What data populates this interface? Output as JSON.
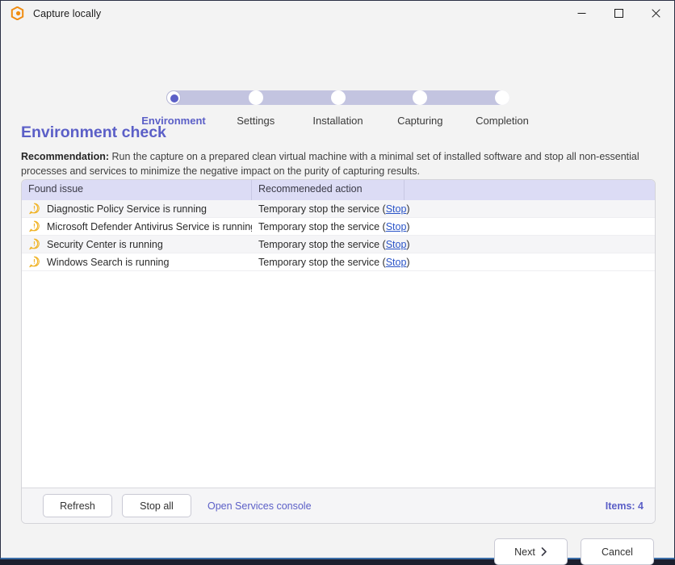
{
  "window": {
    "title": "Capture locally",
    "app_icon": "app-logo-icon",
    "controls": [
      {
        "name": "minimize-button",
        "glyph": "minimize-icon"
      },
      {
        "name": "maximize-button",
        "glyph": "maximize-icon"
      },
      {
        "name": "close-button",
        "glyph": "close-icon"
      }
    ]
  },
  "stepper": {
    "steps": [
      {
        "label": "Environment",
        "active": true
      },
      {
        "label": "Settings",
        "active": false
      },
      {
        "label": "Installation",
        "active": false
      },
      {
        "label": "Capturing",
        "active": false
      },
      {
        "label": "Completion",
        "active": false
      }
    ]
  },
  "page": {
    "title": "Environment check",
    "recommendation_label": "Recommendation:",
    "recommendation_text": " Run the capture on a prepared clean virtual machine with a minimal set of installed software and stop all non-essential processes and services to minimize the negative impact on the purity of capturing results."
  },
  "table": {
    "columns": [
      "Found issue",
      "Recommeneded action",
      ""
    ],
    "rows": [
      {
        "issue": "Diagnostic Policy Service is running",
        "action": "Temporary stop the service (",
        "link": "Stop",
        "action_end": ")"
      },
      {
        "issue": "Microsoft Defender Antivirus Service is running",
        "action": "Temporary stop the service (",
        "link": "Stop",
        "action_end": ")"
      },
      {
        "issue": "Security Center is running",
        "action": "Temporary stop the service (",
        "link": "Stop",
        "action_end": ")"
      },
      {
        "issue": "Windows Search is running",
        "action": "Temporary stop the service (",
        "link": "Stop",
        "action_end": ")"
      }
    ]
  },
  "panel_footer": {
    "refresh_label": "Refresh",
    "stop_all_label": "Stop all",
    "console_link_label": "Open Services console",
    "items_count_label": "Items: 4"
  },
  "wizard_footer": {
    "next_label": "Next",
    "cancel_label": "Cancel"
  },
  "colors": {
    "accent": "#5b5fc7",
    "stepper_track": "#c3c4e0",
    "table_header": "#dcdcf5",
    "link": "#2a54c8",
    "warning": "#f0a818",
    "window_border": "#2b3044",
    "window_border_bottom": "#3b6ea8",
    "app_icon": "#f08c10"
  }
}
